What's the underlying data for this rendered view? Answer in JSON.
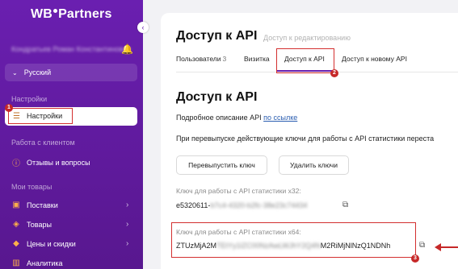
{
  "sidebar": {
    "logo": {
      "left": "WB",
      "right": "Partners"
    },
    "user_name": "Кондратьев Роман Константинович",
    "language": "Русский",
    "sections": {
      "settings": "Настройки",
      "work_with_client": "Работа с клиентом",
      "my_products": "Мои товары"
    },
    "items": {
      "settings": "Настройки",
      "reviews": "Отзывы и вопросы",
      "supplies": "Поставки",
      "products": "Товары",
      "prices": "Цены и скидки",
      "analytics": "Аналитика"
    }
  },
  "header": {
    "title": "Доступ к API",
    "subtitle": "Доступ к редактированию"
  },
  "tabs": [
    {
      "label": "Пользователи",
      "count": "3"
    },
    {
      "label": "Визитка"
    },
    {
      "label": "Доступ к API"
    },
    {
      "label": "Доступ к новому API"
    }
  ],
  "api": {
    "heading": "Доступ к API",
    "description_prefix": "Подробное описание API",
    "description_link": "по ссылке",
    "note": "При перевыпуске действующие ключи для работы с API статистики переста",
    "reissue_button": "Перевыпустить ключ",
    "delete_button": "Удалить ключи",
    "key32_label": "Ключ для работы с API статистики x32:",
    "key32_visible": "e5320611-",
    "key32_hidden": "b7c4-4320-b2fc-38e23c74434",
    "key64_label": "Ключ для работы с API статистики x64:",
    "key64_start": "ZTUzMjA2M",
    "key64_hidden": "TEtYy1lZC00NzAwLWJhY2Q4N",
    "key64_end": "M2RiMjNlNzQ1NDNh"
  },
  "annotations": {
    "badge1": "1",
    "badge2": "2",
    "badge3": "3"
  },
  "icons": {
    "bell": "bell-icon",
    "chevron": "chevron-down-icon",
    "settings": "sliders-icon",
    "reviews": "alert-circle-icon",
    "supplies": "truck-icon",
    "products": "box-icon",
    "prices": "tag-icon",
    "analytics": "bar-chart-icon",
    "copy": "copy-icon"
  },
  "colors": {
    "sidebar": "#6a1fb0",
    "highlight": "#d32f2f",
    "link": "#2a5db0"
  }
}
